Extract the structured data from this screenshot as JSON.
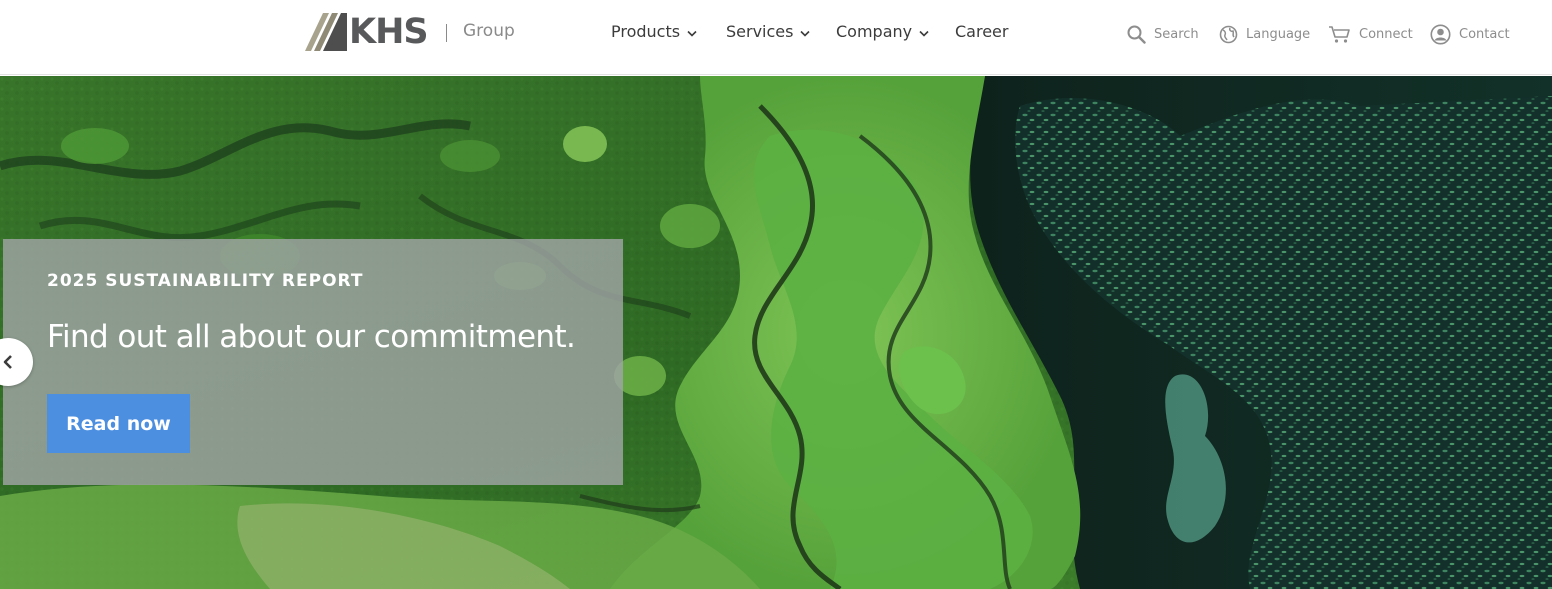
{
  "header": {
    "logo_text": "KHS",
    "logo_group": "Group",
    "nav": [
      {
        "label": "Products",
        "has_dropdown": true
      },
      {
        "label": "Services",
        "has_dropdown": true
      },
      {
        "label": "Company",
        "has_dropdown": true
      },
      {
        "label": "Career",
        "has_dropdown": false
      }
    ],
    "utilities": [
      {
        "label": "Search",
        "icon": "search-icon"
      },
      {
        "label": "Language",
        "icon": "globe-icon"
      },
      {
        "label": "Connect",
        "icon": "cart-icon"
      },
      {
        "label": "Contact",
        "icon": "user-icon"
      }
    ]
  },
  "hero": {
    "eyebrow": "2025 SUSTAINABILITY REPORT",
    "headline": "Find out all about our commitment.",
    "cta_label": "Read now",
    "prev_icon": "chevron-left-icon"
  },
  "colors": {
    "text_dark": "#3c3c3c",
    "text_muted": "#8d8d8d",
    "logo_gray": "#58595b",
    "cta_blue": "#4c8fe0",
    "teaser_overlay": "#a0a5a5"
  }
}
